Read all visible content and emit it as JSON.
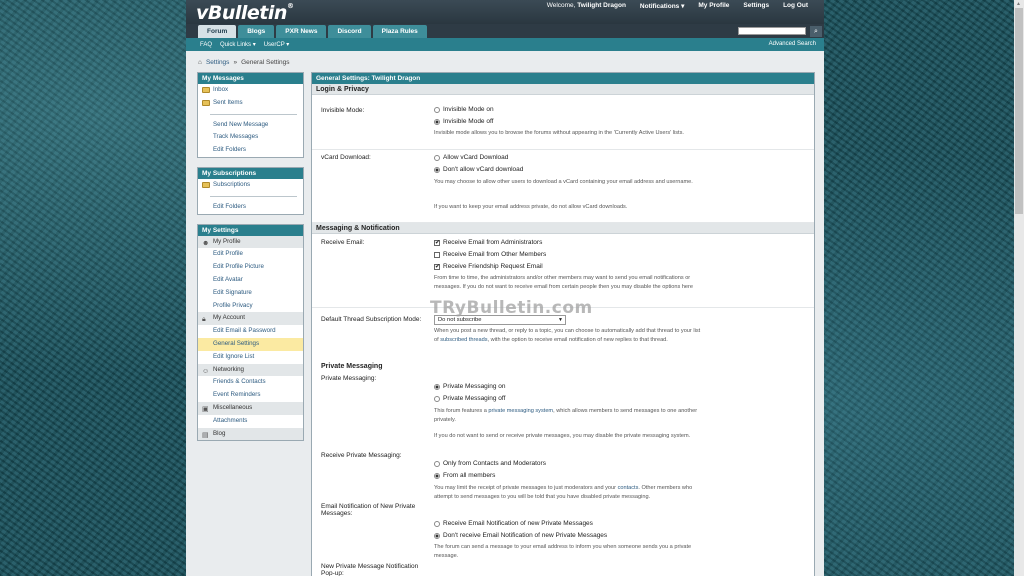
{
  "header": {
    "logo_text": "vBulletin",
    "logo_mark": "®",
    "welcome": "Welcome,",
    "username": "Twilight Dragon",
    "notifications": "Notifications ▾",
    "my_profile": "My Profile",
    "settings": "Settings",
    "logout": "Log Out"
  },
  "tabs": [
    "Forum",
    "Blogs",
    "PXR News",
    "Discord",
    "Plaza Rules"
  ],
  "subnav": {
    "faq": "FAQ",
    "quick_links": "Quick Links ▾",
    "usercp": "UserCP ▾",
    "advanced_search": "Advanced Search"
  },
  "breadcrumb": {
    "settings": "Settings",
    "current": "General Settings",
    "sep": "»"
  },
  "sidebar": {
    "messages": {
      "title": "My Messages",
      "inbox": "Inbox",
      "sent": "Sent Items",
      "send_new": "Send New Message",
      "track": "Track Messages",
      "edit_folders": "Edit Folders"
    },
    "subscriptions": {
      "title": "My Subscriptions",
      "subscriptions": "Subscriptions",
      "edit_folders": "Edit Folders"
    },
    "settings": {
      "title": "My Settings",
      "my_profile": "My Profile",
      "edit_profile": "Edit Profile",
      "edit_profile_picture": "Edit Profile Picture",
      "edit_avatar": "Edit Avatar",
      "edit_signature": "Edit Signature",
      "profile_privacy": "Profile Privacy",
      "my_account": "My Account",
      "edit_email": "Edit Email & Password",
      "general_settings": "General Settings",
      "edit_ignore": "Edit Ignore List",
      "networking": "Networking",
      "friends": "Friends & Contacts",
      "event_reminders": "Event Reminders",
      "misc": "Miscellaneous",
      "attachments": "Attachments",
      "blog": "Blog"
    }
  },
  "main": {
    "title": "General Settings: Twilight Dragon",
    "login_privacy": "Login & Privacy",
    "invisible_label": "Invisible Mode:",
    "invisible_on": "Invisible Mode on",
    "invisible_off": "Invisible Mode off",
    "invisible_desc": "Invisible mode allows you to browse the forums without appearing in the 'Currently Active Users' lists.",
    "vcard_label": "vCard Download:",
    "vcard_allow": "Allow vCard Download",
    "vcard_deny": "Don't allow vCard download",
    "vcard_desc1": "You may choose to allow other users to download a vCard containing your email address and username.",
    "vcard_desc2": "If you want to keep your email address private, do not allow vCard downloads.",
    "messaging": "Messaging & Notification",
    "receive_email_label": "Receive Email:",
    "email_admin": "Receive Email from Administrators",
    "email_members": "Receive Email from Other Members",
    "email_friend": "Receive Friendship Request Email",
    "email_desc": "From time to time, the administrators and/or other members may want to send you email notifications or messages. If you do not want to receive email from certain people then you may disable the options here",
    "thread_sub_label": "Default Thread Subscription Mode:",
    "thread_sub_value": "Do not subscribe",
    "thread_sub_desc_a": "When you post a new thread, or reply to a topic, you can choose to automatically add that thread to your list of",
    "thread_sub_link": "subscribed threads",
    "thread_sub_desc_b": ", with the option to receive email notification of new replies to that thread.",
    "pm_section": "Private Messaging",
    "pm_label": "Private Messaging:",
    "pm_on": "Private Messaging on",
    "pm_off": "Private Messaging off",
    "pm_desc_a": "This forum features a",
    "pm_desc_link": "private messaging system",
    "pm_desc_b": ", which allows members to send messages to one another privately.",
    "pm_desc2": "If you do not want to send or receive private messages, you may disable the private messaging system.",
    "receive_pm_label": "Receive Private Messaging:",
    "pm_contacts": "Only from Contacts and Moderators",
    "pm_all": "From all members",
    "receive_pm_desc_a": "You may limit the receipt of private messages to just moderators and your",
    "receive_pm_desc_link": "contacts",
    "receive_pm_desc_b": ". Other members who attempt to send messages to you will be told that you have disabled private messaging.",
    "email_pm_label": "Email Notification of New Private Messages:",
    "email_pm_on": "Receive Email Notification of new Private Messages",
    "email_pm_off": "Don't receive Email Notification of new Private Messages",
    "email_pm_desc": "The forum can send a message to your email address to inform you when someone sends you a private message.",
    "popup_label": "New Private Message Notification Pop-up:"
  },
  "watermark": "TRyBulletin.com"
}
